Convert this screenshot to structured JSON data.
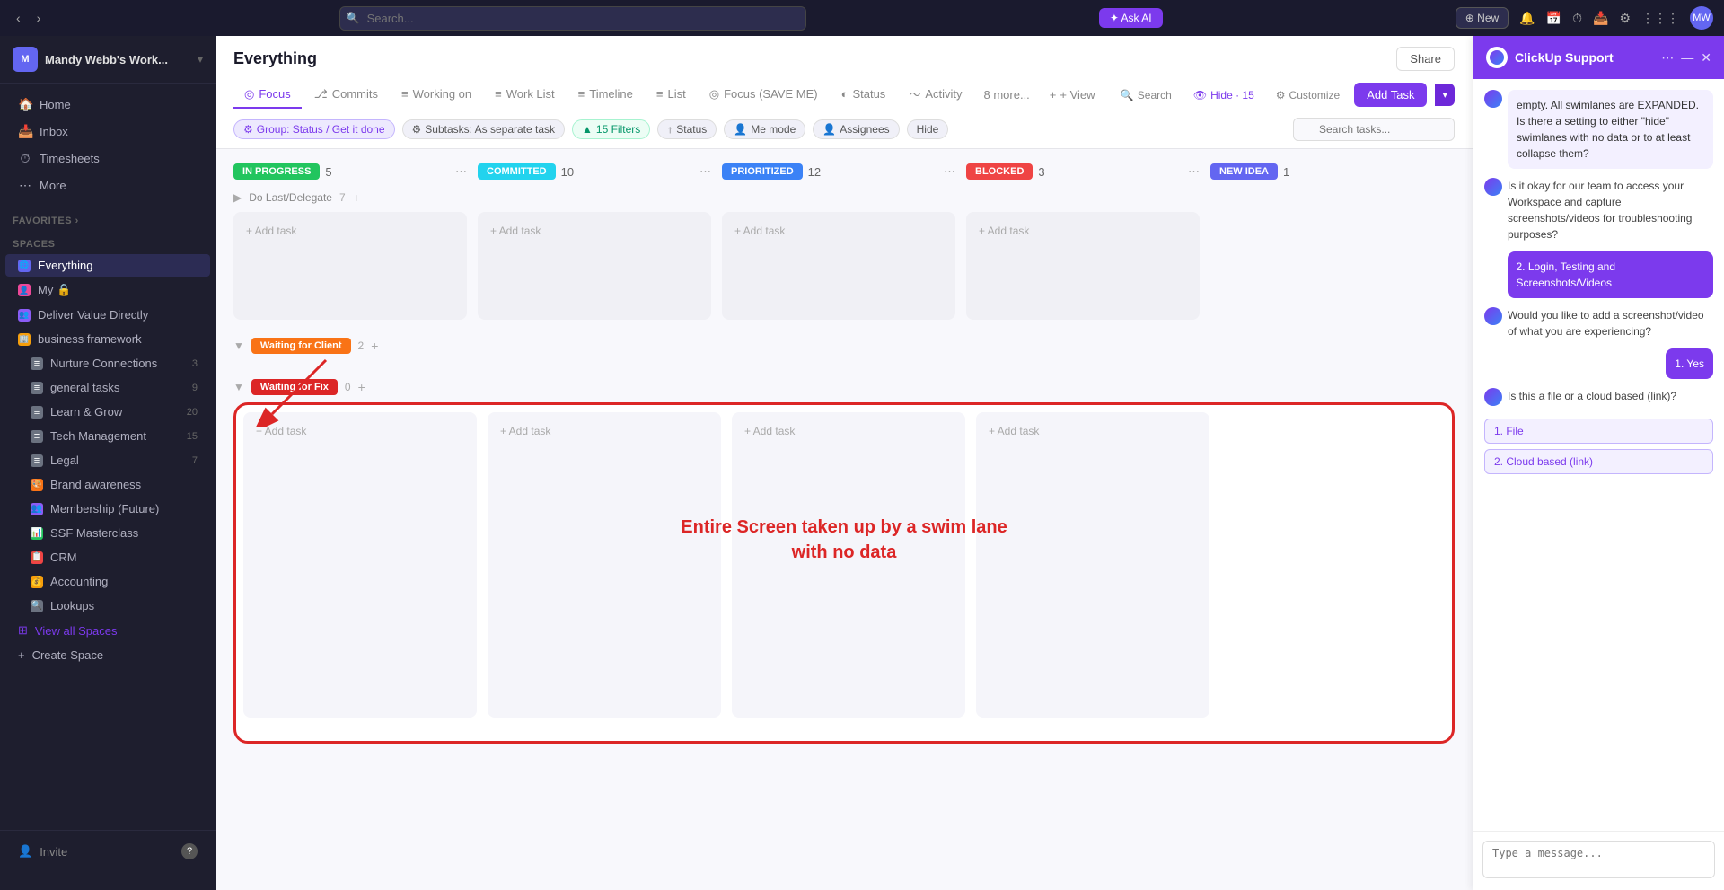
{
  "topbar": {
    "back_btn": "‹",
    "forward_btn": "›",
    "search_placeholder": "Search...",
    "ask_ai_label": "✦ Ask AI",
    "new_btn": "⊕ New",
    "icons": [
      "⏱",
      "📅",
      "📋",
      "🔔",
      "🗔",
      "⚙",
      "⋮⋮⋮"
    ],
    "avatar_initials": "MW"
  },
  "sidebar": {
    "workspace_name": "Mandy Webb's Work...",
    "workspace_icon": "M",
    "nav_items": [
      {
        "id": "home",
        "label": "Home",
        "icon": "🏠"
      },
      {
        "id": "inbox",
        "label": "Inbox",
        "icon": "📥"
      },
      {
        "id": "timesheets",
        "label": "Timesheets",
        "icon": "⏱"
      },
      {
        "id": "more",
        "label": "More",
        "icon": "⋯"
      }
    ],
    "favorites_label": "Favorites ›",
    "spaces_label": "Spaces",
    "spaces": [
      {
        "id": "everything",
        "label": "Everything",
        "icon": "🌐",
        "color": "#6366f1",
        "active": true
      },
      {
        "id": "my",
        "label": "My 🔒",
        "icon": "👤",
        "color": "#ec4899",
        "active": false
      },
      {
        "id": "deliver-value",
        "label": "Deliver Value Directly",
        "icon": "👥",
        "color": "#8b5cf6",
        "active": false
      },
      {
        "id": "business-framework",
        "label": "business framework",
        "icon": "🏢",
        "color": "#f59e0b",
        "count": "",
        "active": false,
        "has_more": true
      }
    ],
    "sub_spaces": [
      {
        "id": "nurture",
        "label": "Nurture Connections",
        "icon": "≡",
        "count": "3"
      },
      {
        "id": "general",
        "label": "general tasks",
        "icon": "≡",
        "count": "9"
      },
      {
        "id": "learn-grow",
        "label": "Learn & Grow",
        "icon": "≡",
        "count": "20"
      },
      {
        "id": "tech",
        "label": "Tech Management",
        "icon": "≡",
        "count": "15"
      },
      {
        "id": "legal",
        "label": "Legal",
        "icon": "≡",
        "count": "7"
      },
      {
        "id": "brand",
        "label": "Brand awareness",
        "icon": "🎨",
        "count": ""
      },
      {
        "id": "membership",
        "label": "Membership (Future)",
        "icon": "👥",
        "count": ""
      },
      {
        "id": "ssf",
        "label": "SSF Masterclass",
        "icon": "📊",
        "count": ""
      },
      {
        "id": "crm",
        "label": "CRM",
        "icon": "📋",
        "count": ""
      },
      {
        "id": "accounting",
        "label": "Accounting",
        "icon": "💰",
        "count": ""
      },
      {
        "id": "lookups",
        "label": "Lookups",
        "icon": "🔍",
        "count": ""
      }
    ],
    "view_all_spaces": "View all Spaces",
    "create_space": "Create Space",
    "invite_label": "Invite",
    "help_icon": "?"
  },
  "header": {
    "title": "Everything",
    "share_label": "Share",
    "tabs": [
      {
        "id": "focus",
        "label": "Focus",
        "icon": "◎",
        "active": true
      },
      {
        "id": "commits",
        "label": "Commits",
        "icon": "⎇"
      },
      {
        "id": "working-on",
        "label": "Working on",
        "icon": "≡"
      },
      {
        "id": "work-list",
        "label": "Work List",
        "icon": "≡"
      },
      {
        "id": "timeline",
        "label": "Timeline",
        "icon": "≡"
      },
      {
        "id": "list",
        "label": "List",
        "icon": "≡"
      },
      {
        "id": "focus-save",
        "label": "Focus (SAVE ME)",
        "icon": "◎"
      },
      {
        "id": "status",
        "label": "Status",
        "icon": "◐"
      },
      {
        "id": "activity",
        "label": "Activity",
        "icon": "〜"
      },
      {
        "id": "more-tabs",
        "label": "8 more..."
      }
    ],
    "add_view_label": "+ View",
    "search_label": "Search",
    "hide_label": "Hide · 15",
    "customize_label": "Customize",
    "add_task_label": "Add Task"
  },
  "filters": {
    "chips": [
      {
        "id": "group",
        "label": "Group: Status / Get it done",
        "icon": "⚙",
        "style": "purple"
      },
      {
        "id": "subtasks",
        "label": "Subtasks: As separate task",
        "icon": "⚙"
      },
      {
        "id": "filters",
        "label": "15 Filters",
        "icon": "▲",
        "style": "green"
      },
      {
        "id": "status",
        "label": "Status",
        "icon": "↑"
      },
      {
        "id": "me-mode",
        "label": "Me mode",
        "icon": "👤"
      },
      {
        "id": "assignees",
        "label": "Assignees",
        "icon": "👤"
      },
      {
        "id": "hide",
        "label": "Hide"
      }
    ],
    "search_placeholder": "Search tasks..."
  },
  "kanban": {
    "swim_lanes": [
      {
        "id": "in-progress",
        "label": "IN PROGRESS",
        "count": "5",
        "color": "#22c55e",
        "style": "in-progress"
      },
      {
        "id": "committed",
        "label": "COMMITTED",
        "count": "10",
        "color": "#22d3ee",
        "style": "committed"
      },
      {
        "id": "prioritized",
        "label": "PRIORITIZED",
        "count": "12",
        "color": "#3b82f6",
        "style": "prioritized"
      },
      {
        "id": "blocked",
        "label": "BLOCKED",
        "count": "3",
        "color": "#ef4444",
        "style": "blocked"
      },
      {
        "id": "new-idea",
        "label": "NEW IDEA",
        "count": "1",
        "color": "#6366f1",
        "style": "new-idea"
      }
    ],
    "group_do_last": {
      "label": "Do Last/Delegate",
      "count": "7"
    },
    "group_waiting_client": {
      "label": "Waiting for Client",
      "count": "2"
    },
    "group_waiting_fix": {
      "label": "Waiting for Fix",
      "count": "0"
    },
    "add_task_label": "+ Add task",
    "annotation_text": "Entire Screen taken up by a swim lane\nwith no data"
  },
  "chat": {
    "title": "ClickUp Support",
    "messages": [
      {
        "type": "support",
        "text": "empty. All swimlanes are EXPANDED. Is there a setting to either \"hide\" swimlanes with no data or to at least collapse them?"
      },
      {
        "type": "support-question",
        "text": "Is it okay for our team to access your Workspace and capture screenshots/videos for troubleshooting purposes?"
      },
      {
        "type": "user",
        "text": "2. Login, Testing and Screenshots/Videos"
      },
      {
        "type": "support-question",
        "text": "Would you like to add a screenshot/video of what you are experiencing?"
      },
      {
        "type": "user",
        "text": "1. Yes"
      },
      {
        "type": "support-question",
        "text": "Is this a file or a cloud based (link)?"
      },
      {
        "type": "options",
        "options": [
          "1. File",
          "2. Cloud based (link)"
        ]
      }
    ],
    "input_placeholder": "Type a message..."
  }
}
